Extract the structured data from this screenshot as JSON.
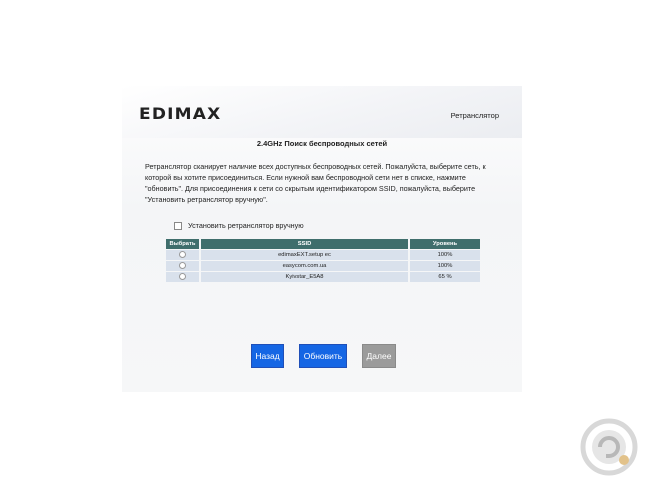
{
  "header": {
    "logo_text": "EDIMAX",
    "mode_label": "Ретранслятор"
  },
  "page": {
    "title": "2.4GHz Поиск беспроводных сетей",
    "description_lines": [
      "Ретранслятор сканирует наличие всех доступных беспроводных сетей. Пожалуйста, выберите сеть, к",
      "которой вы хотите присоединиться. Если нужной вам беспроводной сети нет в списке, нажмите",
      "\"обновить\". Для присоединения к сети со скрытым идентификатором SSID, пожалуйста, выберите",
      "\"Установить ретранслятор вручную\"."
    ],
    "manual_setup_label": "Установить ретранслятор вручную",
    "manual_setup_checked": false
  },
  "table": {
    "columns": [
      "Выбрать",
      "SSID",
      "Уровень"
    ],
    "rows": [
      {
        "ssid": "edimaxEXT.setup ec",
        "level": "100%"
      },
      {
        "ssid": "easycom.com.ua",
        "level": "100%"
      },
      {
        "ssid": "Kyivstar_E5A8",
        "level": "65 %"
      }
    ]
  },
  "buttons": {
    "back": "Назад",
    "refresh": "Обновить",
    "next": "Далее"
  },
  "colors": {
    "table_header": "#3f6e6c",
    "table_row": "#d9e1ec",
    "button_blue": "#1566e4",
    "button_disabled": "#9b9b9b"
  }
}
